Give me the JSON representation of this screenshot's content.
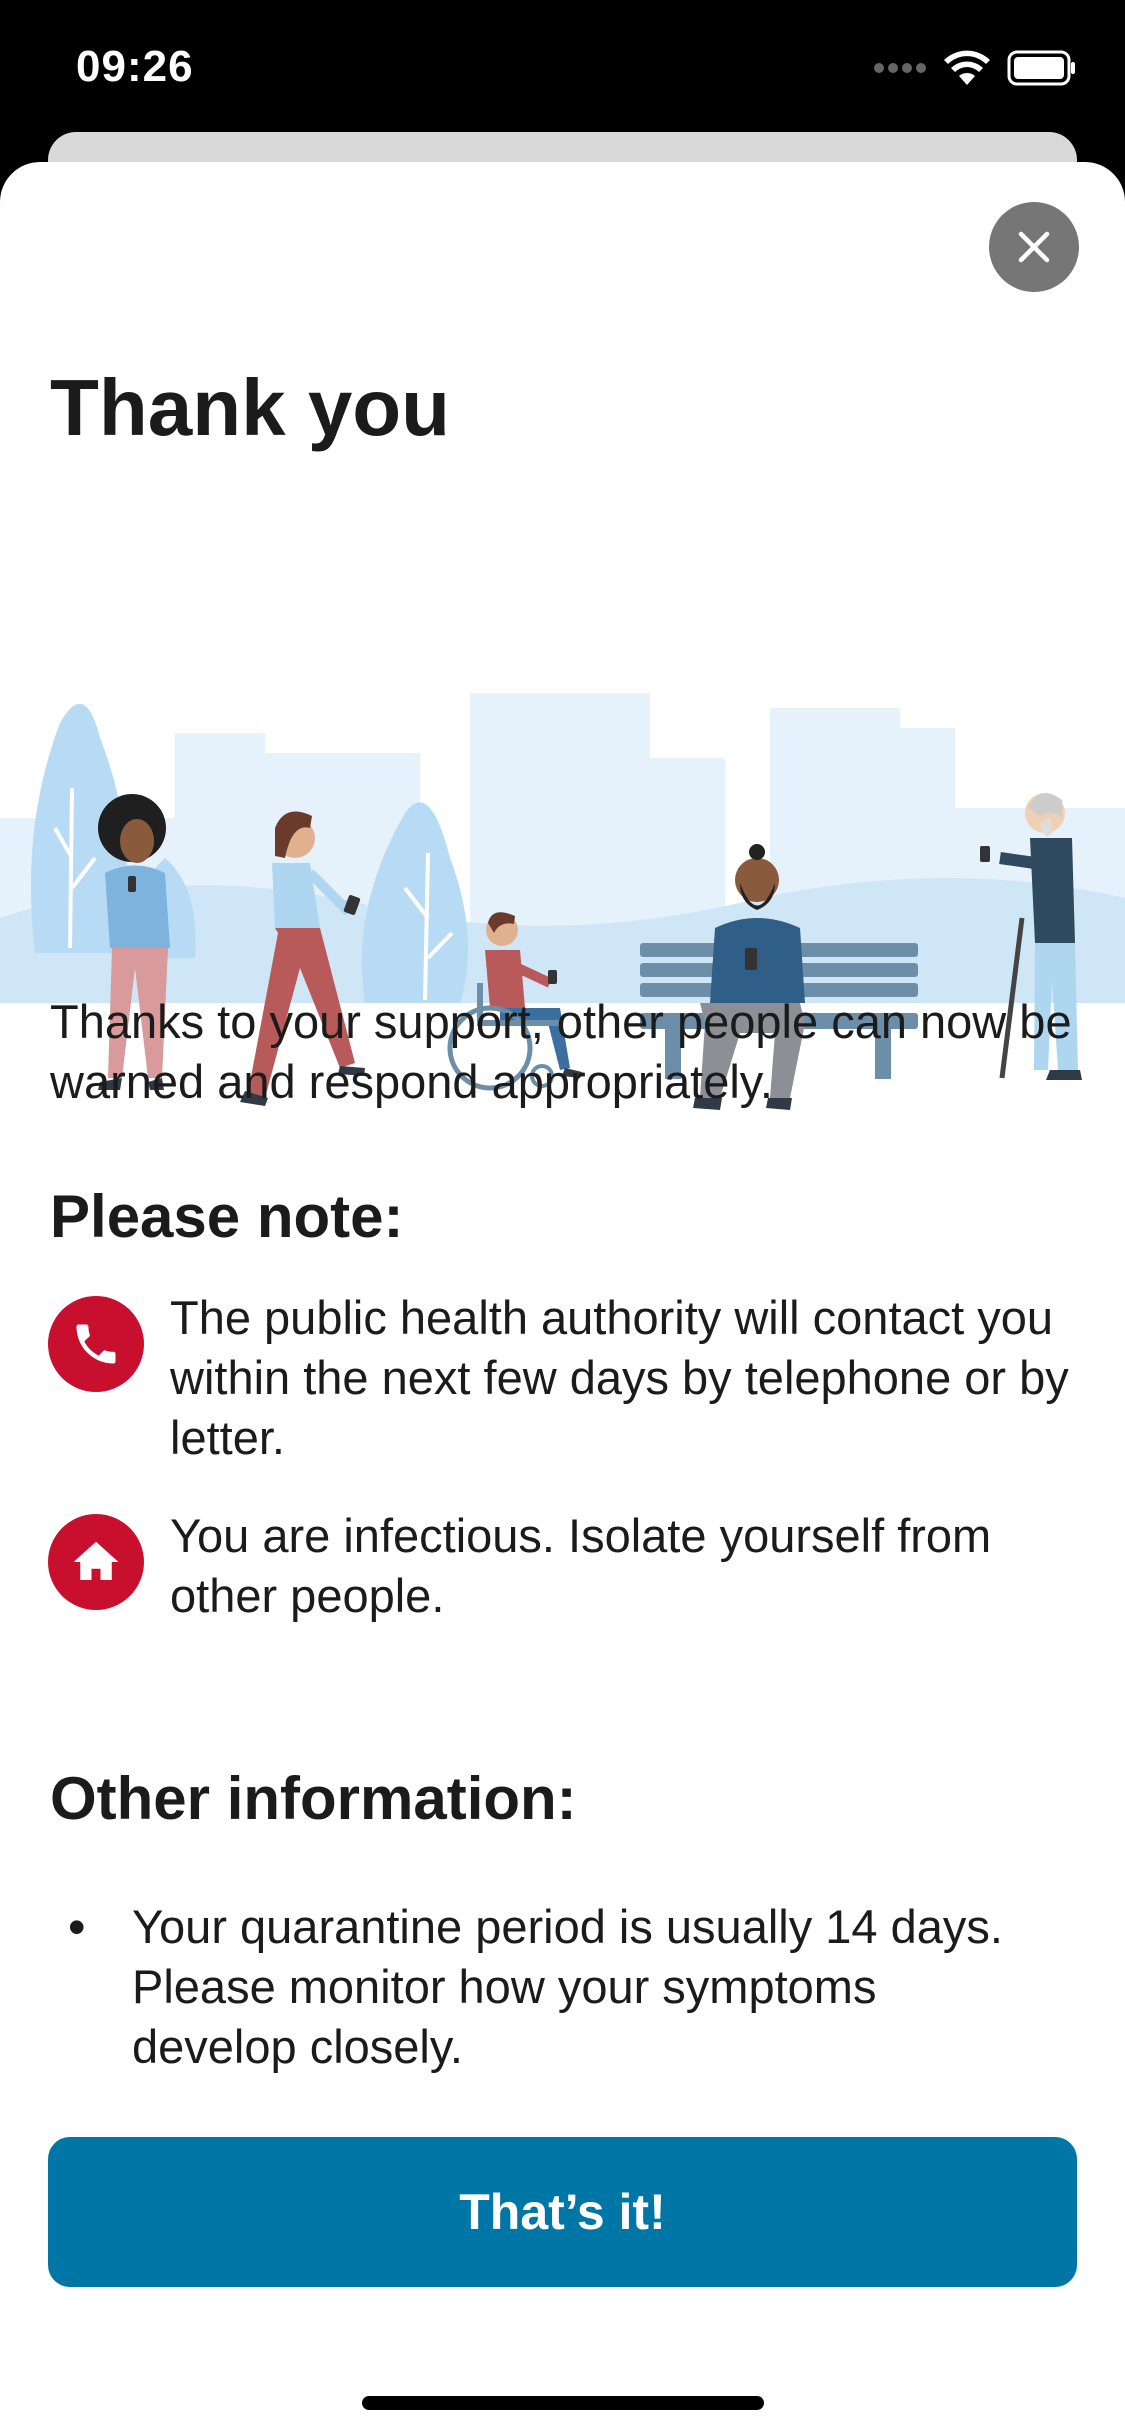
{
  "status_bar": {
    "time": "09:26"
  },
  "title": "Thank you",
  "intro_text": "Thanks to your support, other people can now be warned and respond appropriately.",
  "please_note": {
    "heading": "Please note:",
    "items": [
      {
        "icon": "phone-icon",
        "text": "The public health authority will contact you within the next few days by telephone or by letter."
      },
      {
        "icon": "home-icon",
        "text": "You are infectious. Isolate yourself from other people."
      }
    ]
  },
  "other_information": {
    "heading": "Other information:",
    "bullets": [
      {
        "text": "Your quarantine period is usually 14 days. Please monitor how your symptoms develop closely."
      }
    ]
  },
  "cta": {
    "label": "That’s it!"
  },
  "colors": {
    "accent": "#0076a6",
    "alert_red": "#c8102e",
    "close_gray": "#767676"
  }
}
